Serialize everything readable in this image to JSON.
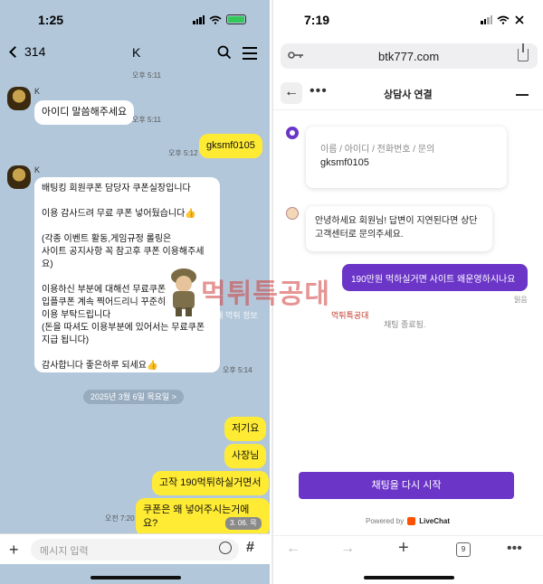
{
  "left": {
    "status_time": "1:25",
    "back_count": "314",
    "chat_title": "K",
    "sender_name": "K",
    "messages": {
      "ts_top": "오후 5:11",
      "m1": "아이디 말씀해주세요",
      "m1_ts": "오후 5:11",
      "m2": "gksmf0105",
      "m2_ts": "오후 5:12",
      "m3": "배팅킹 회원쿠폰 담당자 쿠폰실장입니다\n\n이용 감사드려 무료 쿠폰 넣어뒀습니다👍\n\n(각종 이벤트 활동,게임규정 롤링은\n사이트 공지사항 꼭 참고후 쿠폰 이용해주세\n요)\n\n이용하신 부분에 대해선 무료쿠폰\n입플쿠폰 계속 찍어드리니 꾸준히\n이용 부탁드립니다\n(돈을 따셔도 이용부분에 있어서는 무료쿠폰\n지급 됩니다)\n\n감사합니다 좋은하루 되세요👍",
      "m3_ts": "오후 5:14",
      "date_divider": "2025년 3월 6일 목요일 >",
      "m4": "저기요",
      "m5": "사장님",
      "m6": "고작 190먹튀하실거면서",
      "m7": "쿠폰은 왜 넣어주시는거에요?",
      "m7_ts": "오전 7:20",
      "date_badge": "3. 06. 목"
    },
    "input_placeholder": "메시지 입력"
  },
  "watermark": {
    "big": "먹튀특공대",
    "sub_left": "최대 먹튀 정보",
    "sub_right": "먹튀특공대"
  },
  "right": {
    "status_time": "7:19",
    "url": "btk777.com",
    "header_title": "상담사 연결",
    "form_label": "이름 / 아이디 / 전화번호 / 문의",
    "form_value": "gksmf0105",
    "agent_message": "안녕하세요 회원님! 답변이 지연된다면 상단 고객센터로 문의주세요.",
    "user_message": "190만원 먹하실거면 사이트 왜운영하시나요",
    "read_label": "읽음",
    "chat_ended": "채팅 종료됨.",
    "restart_button": "채팅을 다시 시작",
    "powered_by": "Powered by",
    "livechat": "LiveChat",
    "tabs_count": "9"
  },
  "colors": {
    "chat_bg": "#b2c7da",
    "my_bubble": "#ffeb33",
    "livechat_purple": "#6b35c8"
  }
}
